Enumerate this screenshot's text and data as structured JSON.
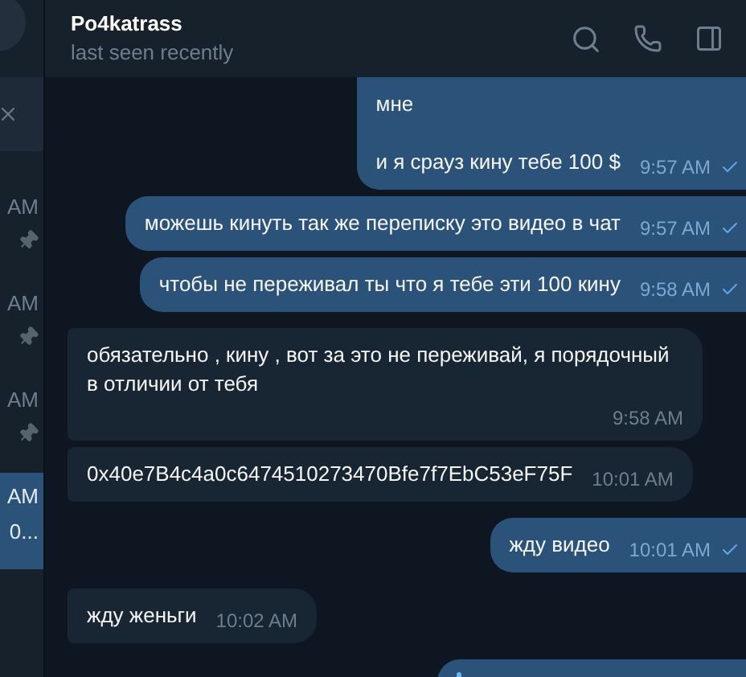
{
  "sidebar": {
    "chats": [
      {
        "time": "AM",
        "pinned": true,
        "selected": false
      },
      {
        "time": "AM",
        "pinned": true,
        "selected": false
      },
      {
        "time": "AM",
        "pinned": true,
        "selected": false
      },
      {
        "time": "AM",
        "preview": "0...",
        "pinned": false,
        "selected": true
      }
    ]
  },
  "header": {
    "title": "Po4katrass",
    "status": "last seen recently"
  },
  "messages": [
    {
      "kind": "outgoing",
      "text": "мне\n\nи я срауз кину тебе 100 $",
      "time": "9:57 AM"
    },
    {
      "kind": "outgoing",
      "text": "можешь кинуть так же переписку это видео в чат",
      "time": "9:57 AM"
    },
    {
      "kind": "outgoing",
      "text": "чтобы не переживал ты что я тебе эти 100 кину",
      "time": "9:58 AM"
    },
    {
      "kind": "incoming",
      "text": "обязательно , кину , вот за это не переживай, я порядочный в отличии от тебя",
      "time": "9:58 AM"
    },
    {
      "kind": "incoming",
      "text": "0x40e7B4c4a0c6474510273470Bfe7f7EbC53eF75F",
      "time": "10:01 AM"
    },
    {
      "kind": "outgoing",
      "text": "жду видео",
      "time": "10:01 AM"
    },
    {
      "kind": "incoming",
      "text": "жду женьги",
      "time": "10:02 AM"
    }
  ]
}
